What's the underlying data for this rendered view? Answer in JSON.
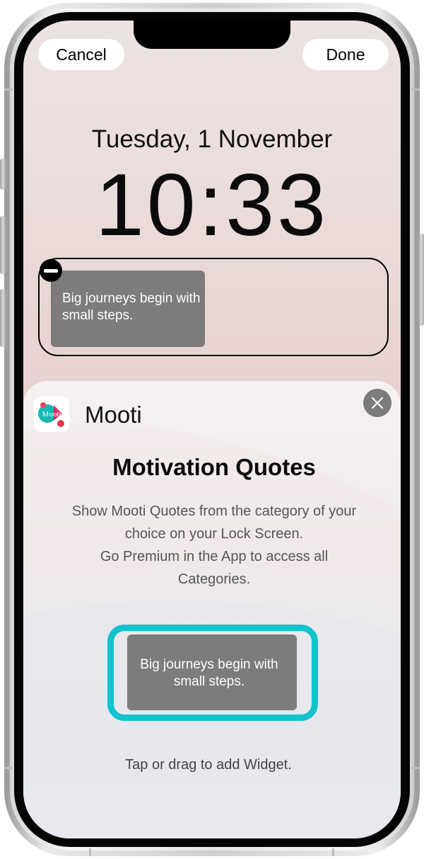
{
  "header": {
    "cancel_label": "Cancel",
    "done_label": "Done"
  },
  "lock_screen": {
    "date": "Tuesday, 1 November",
    "time": "10:33",
    "widget_text": "Big journeys begin with small steps."
  },
  "widget_sheet": {
    "app_name": "Mooti",
    "app_icon_label": "Mooti",
    "title": "Motivation Quotes",
    "description_lines": [
      "Show Mooti Quotes from the category of your",
      "choice on your Lock Screen.",
      "Go Premium in the App to access all",
      "Categories."
    ],
    "preview_text": "Big journeys begin with small steps.",
    "hint": "Tap or drag to add Widget."
  },
  "icons": {
    "remove": "minus-circle-icon",
    "close": "close-icon"
  },
  "colors": {
    "accent": "#12c2cc",
    "widget_background": "#7d7b7b",
    "close_button": "#7b7b7e"
  }
}
